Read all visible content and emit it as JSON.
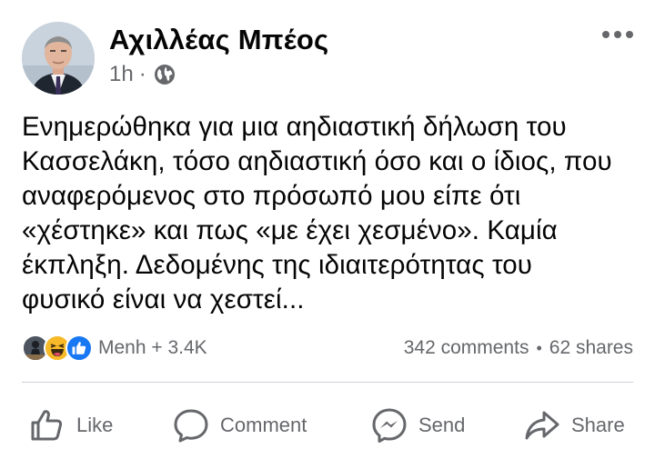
{
  "post": {
    "author": "Αχιλλέας Μπέος",
    "time": "1h",
    "separator": "·",
    "privacy_icon": "globe-icon",
    "text_lines": [
      "Ενημερώθηκα για μια αηδιαστική δήλωση του",
      "Κασσελάκη, τόσο αηδιαστική όσο και ο ίδιος, που",
      "αναφερόμενος στο πρόσωπό μου είπε ότι",
      "«χέστηκε» και πως «με έχει χεσμένο». Καμία",
      "έκπληξη. Δεδομένης της ιδιαιτερότητας του",
      "φυσικό είναι να χεστεί..."
    ]
  },
  "reactions": {
    "icons": [
      "profile-photo-icon",
      "haha-icon",
      "like-icon"
    ],
    "label": "Menh + 3.4K",
    "comments": "342 comments",
    "dot": "•",
    "shares": "62 shares"
  },
  "actions": {
    "like": "Like",
    "comment": "Comment",
    "send": "Send",
    "share": "Share"
  },
  "colors": {
    "text": "#050505",
    "secondary": "#65676b",
    "like_blue": "#1877f2",
    "haha_yellow": "#f7b928",
    "divider": "#ced0d4"
  }
}
